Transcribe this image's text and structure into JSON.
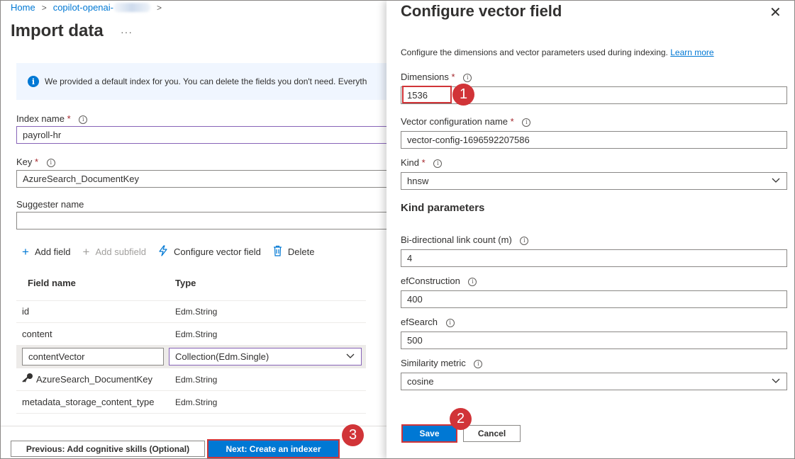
{
  "breadcrumb": {
    "home": "Home",
    "resource": "copilot-openai-"
  },
  "page": {
    "title": "Import data",
    "more": "···"
  },
  "info": {
    "icon": "info-icon",
    "text": "We provided a default index for you. You can delete the fields you don't need. Everyth"
  },
  "form": {
    "index_name_label": "Index name",
    "index_name_value": "payroll-hr",
    "key_label": "Key",
    "key_value": "AzureSearch_DocumentKey",
    "suggester_label": "Suggester name",
    "suggester_value": "",
    "required_mark": "*",
    "tooltip_glyph": "i"
  },
  "toolbar": {
    "add_field": "Add field",
    "add_subfield": "Add subfield",
    "configure_vector": "Configure vector field",
    "delete": "Delete"
  },
  "table": {
    "headers": {
      "name": "Field name",
      "type": "Type"
    },
    "rows": [
      {
        "name": "id",
        "type": "Edm.String"
      },
      {
        "name": "content",
        "type": "Edm.String"
      },
      {
        "name": "contentVector",
        "type": "Collection(Edm.Single)"
      },
      {
        "name": "AzureSearch_DocumentKey",
        "type": "Edm.String"
      },
      {
        "name": "metadata_storage_content_type",
        "type": "Edm.String"
      }
    ]
  },
  "footer": {
    "previous": "Previous: Add cognitive skills (Optional)",
    "next": "Next: Create an indexer"
  },
  "panel": {
    "title": "Configure vector field",
    "close": "✕",
    "description": "Configure the dimensions and vector parameters used during indexing.",
    "learn_more": "Learn more",
    "dimensions_label": "Dimensions",
    "dimensions_value": "1536",
    "vector_config_label": "Vector configuration name",
    "vector_config_value": "vector-config-1696592207586",
    "kind_label": "Kind",
    "kind_value": "hnsw",
    "kind_params_heading": "Kind parameters",
    "link_count_label": "Bi-directional link count (m)",
    "link_count_value": "4",
    "ef_construction_label": "efConstruction",
    "ef_construction_value": "400",
    "ef_search_label": "efSearch",
    "ef_search_value": "500",
    "similarity_label": "Similarity metric",
    "similarity_value": "cosine",
    "save": "Save",
    "cancel": "Cancel"
  },
  "annotations": {
    "step1": "1",
    "step2": "2",
    "step3": "3"
  },
  "colors": {
    "accent": "#0078d4",
    "highlight": "#d13438",
    "required": "#a4262c"
  }
}
